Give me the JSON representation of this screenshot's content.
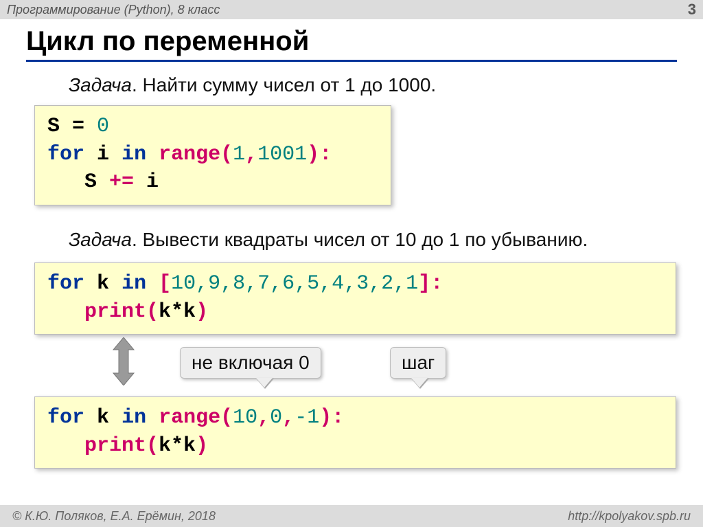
{
  "header": {
    "course": "Программирование (Python), 8 класс",
    "page": "3"
  },
  "title": "Цикл по переменной",
  "task1": {
    "label": "Задача",
    "text": ". Найти сумму чисел от 1 до 1000."
  },
  "task2": {
    "label": "Задача",
    "text": ". Вывести квадраты чисел от 10 до 1 по убыванию."
  },
  "code1": {
    "l1": {
      "var": "S",
      "eq": " = ",
      "zero": "0"
    },
    "l2": {
      "for": "for",
      "sp1": " ",
      "i": "i",
      "sp2": " ",
      "in": "in",
      "sp3": " ",
      "range": "range",
      "lp": "(",
      "a": "1",
      "comma": ",",
      "b": "1001",
      "rp": ")",
      "colon": ":"
    },
    "l3": {
      "indent": "   ",
      "var": "S",
      "op": " += ",
      "i": "i"
    }
  },
  "code2": {
    "l1": {
      "for": "for",
      "sp1": " ",
      "k": "k",
      "sp2": " ",
      "in": "in",
      "sp3": " ",
      "lb": "[",
      "list": "10,9,8,7,6,5,4,3,2,1",
      "rb": "]",
      "colon": ":"
    },
    "l2": {
      "indent": "   ",
      "print": "print",
      "lp": "(",
      "expr": "k*k",
      "rp": ")"
    }
  },
  "code3": {
    "l1": {
      "for": "for",
      "sp1": " ",
      "k": "k",
      "sp2": " ",
      "in": "in",
      "sp3": " ",
      "range": "range",
      "lp": "(",
      "a": "10",
      "c1": ",",
      "b": "0",
      "c2": ",",
      "c": "-1",
      "rp": ")",
      "colon": ":"
    },
    "l2": {
      "indent": "   ",
      "print": "print",
      "lp": "(",
      "expr": "k*k",
      "rp": ")"
    }
  },
  "callouts": {
    "exclude_zero": "не включая 0",
    "step": "шаг"
  },
  "footer": {
    "copyright": "© К.Ю. Поляков, Е.А. Ерёмин, 2018",
    "url": "http://kpolyakov.spb.ru"
  }
}
